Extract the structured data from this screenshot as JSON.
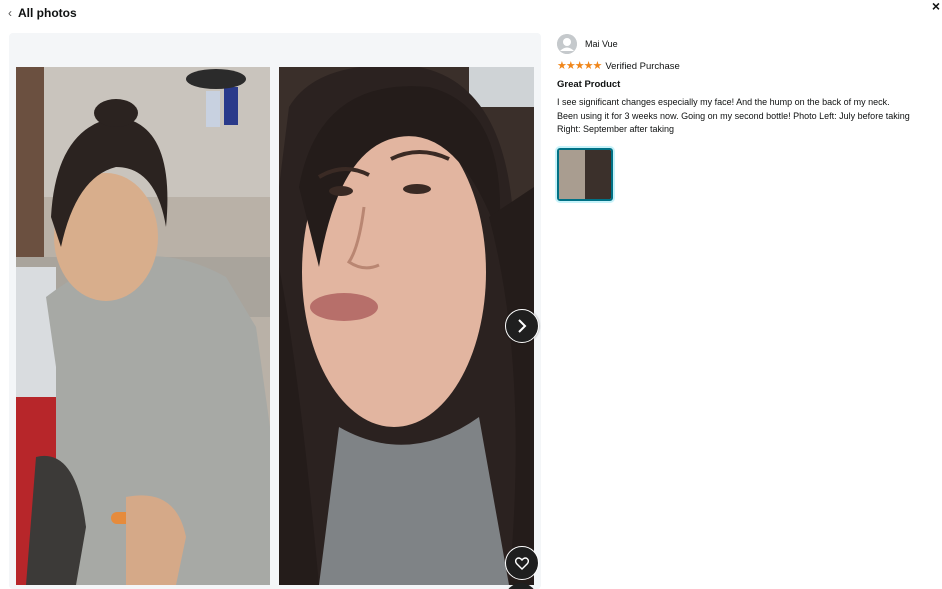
{
  "header": {
    "back_chevron": "‹",
    "back_label": "All photos",
    "close_label": "×"
  },
  "icons": {
    "back": "chevron-left-icon",
    "close": "close-icon",
    "next": "chevron-right-icon",
    "like": "heart-icon",
    "avatar": "user-avatar-icon",
    "star": "star-icon"
  },
  "review": {
    "reviewer_name": "Mai Vue",
    "stars": "★★★★★",
    "rating": 5,
    "verified_label": "Verified Purchase",
    "title": "Great Product",
    "body": "I see significant changes especially my face! And the hump on the back of my neck. Been using it for 3 weeks now. Going on my second bottle! Photo Left: July before taking Right: September after taking"
  },
  "colors": {
    "star": "#f0861a",
    "thumb_border": "#007185",
    "panel_bg": "#f4f6f8",
    "nav_button": "#1f1f1f"
  }
}
